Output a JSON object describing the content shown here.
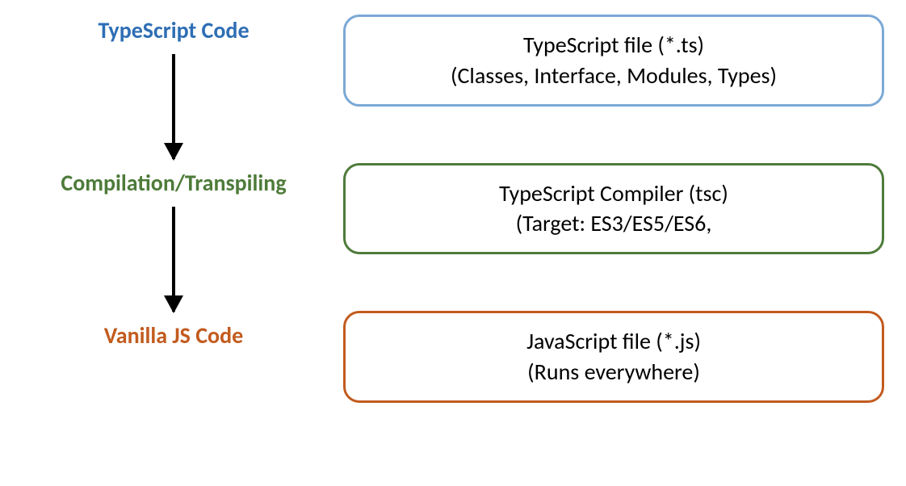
{
  "diagram": {
    "left": {
      "step1": "TypeScript Code",
      "step2": "Compilation/Transpiling",
      "step3": "Vanilla JS Code"
    },
    "right": {
      "box1": {
        "line1": "TypeScript file (*.ts)",
        "line2": "(Classes, Interface, Modules, Types)"
      },
      "box2": {
        "line1": "TypeScript Compiler (tsc)",
        "line2": "(Target: ES3/ES5/ES6,"
      },
      "box3": {
        "line1": "JavaScript file (*.js)",
        "line2": "(Runs everywhere)"
      }
    },
    "colors": {
      "blue": "#2E6EB5",
      "green": "#4E7B3A",
      "orange": "#C25B1E",
      "boxBlue": "#7BA9D6"
    }
  }
}
